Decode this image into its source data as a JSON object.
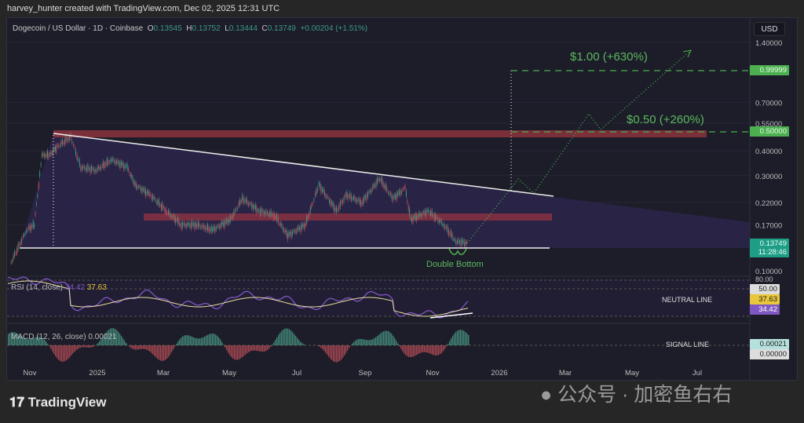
{
  "header": {
    "credit": "harvey_hunter created with TradingView.com, Dec 02, 2025 12:31 UTC"
  },
  "legend": {
    "symbol": "Dogecoin / US Dollar · 1D · Coinbase",
    "o_label": "O",
    "o": "0.13545",
    "h_label": "H",
    "h": "0.13752",
    "l_label": "L",
    "l": "0.13444",
    "c_label": "C",
    "c": "0.13749",
    "change": "+0.00204 (+1.51%)"
  },
  "currency_button": "USD",
  "price_axis": [
    "1.40000",
    "0.70000",
    "0.55000",
    "0.40000",
    "0.30000",
    "0.22000",
    "0.17000",
    "0.10000"
  ],
  "price_tags": {
    "target1": "0.99999",
    "target2": "0.50000",
    "last": "0.13749",
    "countdown": "11:28:46"
  },
  "annotations": {
    "target1": "$1.00 (+630%)",
    "target2": "$0.50 (+260%)",
    "pattern": "Double Bottom",
    "neutral": "NEUTRAL LINE",
    "signal": "SIGNAL LINE"
  },
  "rsi": {
    "label": "RSI (14, close)",
    "value1": "34.42",
    "value2": "37.63",
    "axis_top": "80.00",
    "tags": [
      "50.00",
      "37.63",
      "34.42"
    ]
  },
  "macd": {
    "label": "MACD (12, 26, close)",
    "value": "0.00021",
    "tags": [
      "0.00021",
      "0.00000"
    ]
  },
  "time_axis": [
    "Nov",
    "2025",
    "Mar",
    "May",
    "Jul",
    "Sep",
    "Nov",
    "2026",
    "Mar",
    "May",
    "Jul"
  ],
  "footer": {
    "logo": "TradingView",
    "watermark": "公众号 · 加密鱼右右"
  },
  "colors": {
    "up": "#3c9a83",
    "down": "#c0505a",
    "target": "#4caf50",
    "rsi": "#7e57c2",
    "zone": "#9b3540"
  },
  "chart_data": {
    "type": "candlestick",
    "title": "Dogecoin / US Dollar · 1D · Coinbase",
    "yscale": "log",
    "ylim": [
      0.095,
      1.5
    ],
    "x": [
      "2024-10-15",
      "2024-10-29",
      "2024-11-05",
      "2024-11-12",
      "2024-11-19",
      "2024-11-26",
      "2024-12-08",
      "2024-12-17",
      "2024-12-31",
      "2025-01-14",
      "2025-01-28",
      "2025-02-04",
      "2025-02-18",
      "2025-03-04",
      "2025-03-18",
      "2025-04-01",
      "2025-04-15",
      "2025-05-01",
      "2025-05-12",
      "2025-05-27",
      "2025-06-10",
      "2025-06-22",
      "2025-07-08",
      "2025-07-20",
      "2025-08-05",
      "2025-08-14",
      "2025-08-28",
      "2025-09-13",
      "2025-09-25",
      "2025-10-06",
      "2025-10-11",
      "2025-10-27",
      "2025-11-10",
      "2025-11-21",
      "2025-12-02"
    ],
    "close": [
      0.11,
      0.16,
      0.17,
      0.38,
      0.38,
      0.42,
      0.47,
      0.33,
      0.32,
      0.36,
      0.33,
      0.27,
      0.24,
      0.2,
      0.17,
      0.17,
      0.16,
      0.18,
      0.23,
      0.2,
      0.19,
      0.15,
      0.17,
      0.27,
      0.2,
      0.24,
      0.22,
      0.29,
      0.23,
      0.26,
      0.18,
      0.2,
      0.17,
      0.14,
      0.1375
    ],
    "levels": {
      "support": 0.135,
      "resistance_zone": 0.19,
      "target1": 1.0,
      "target2": 0.5
    }
  }
}
